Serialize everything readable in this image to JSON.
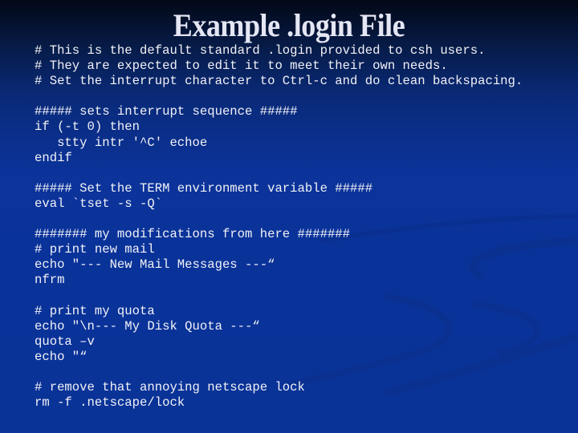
{
  "slide": {
    "title": "Example .login File",
    "background": {
      "top_color": "#020816",
      "bottom_color": "#0a3398"
    },
    "text_color": "#f2f2f6",
    "code_lines": [
      "# This is the default standard .login provided to csh users.",
      "# They are expected to edit it to meet their own needs.",
      "# Set the interrupt character to Ctrl-c and do clean backspacing.",
      "",
      "##### sets interrupt sequence #####",
      "if (-t 0) then",
      "   stty intr '^C' echoe",
      "endif",
      "",
      "##### Set the TERM environment variable #####",
      "eval `tset -s -Q`",
      "",
      "####### my modifications from here #######",
      "# print new mail",
      "echo \"--- New Mail Messages ---“",
      "nfrm",
      "",
      "# print my quota",
      "echo \"\\n--- My Disk Quota ---“",
      "quota –v",
      "echo \"“",
      "",
      "# remove that annoying netscape lock",
      "rm -f .netscape/lock"
    ]
  }
}
